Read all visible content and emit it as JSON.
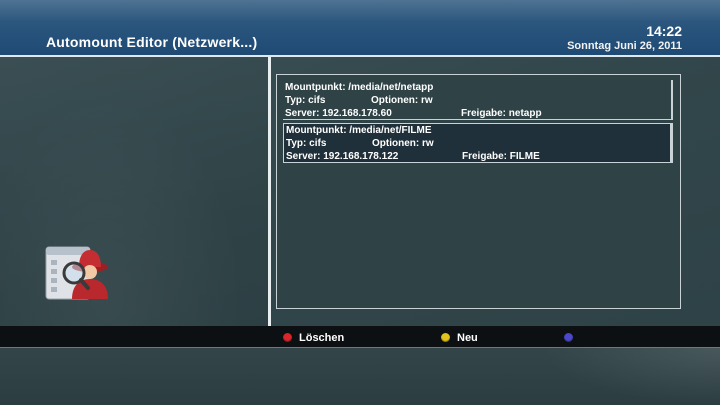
{
  "header": {
    "title": "Automount Editor (Netzwerk...)",
    "time": "14:22",
    "date": "Sonntag Juni 26, 2011"
  },
  "mounts": [
    {
      "mountpoint_line": "Mountpunkt: /media/net/netapp",
      "type_line": "Typ: cifs",
      "options_line": "Optionen: rw",
      "server_line": "Server: 192.168.178.60",
      "share_line": "Freigabe: netapp",
      "selected": false
    },
    {
      "mountpoint_line": "Mountpunkt: /media/net/FILME",
      "type_line": "Typ: cifs",
      "options_line": "Optionen: rw",
      "server_line": "Server: 192.168.178.122",
      "share_line": "Freigabe: FILME",
      "selected": true
    }
  ],
  "buttons": {
    "red": {
      "label": "Löschen",
      "color": "#d8262a"
    },
    "yellow": {
      "label": "Neu",
      "color": "#e3c21c"
    },
    "blue": {
      "label": "",
      "color": "#4b49c9"
    }
  },
  "icon": {
    "name": "network-user-search-icon"
  }
}
